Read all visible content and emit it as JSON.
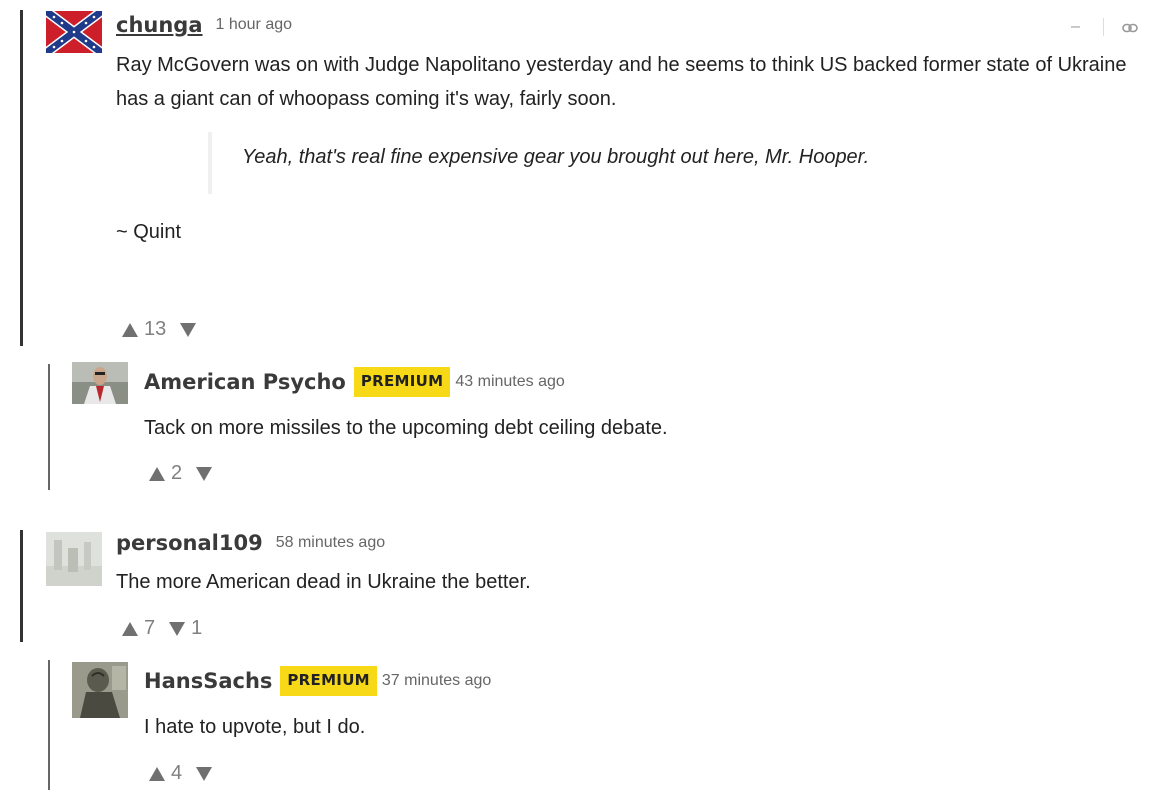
{
  "controls": {
    "collapse_glyph": "–",
    "link_icon": "link-icon"
  },
  "colors": {
    "premium_badge": "#f7d917",
    "thread_line": "#333333",
    "username": "#3a3a3a"
  },
  "comments": [
    {
      "username": "chunga",
      "timestamp": "1 hour ago",
      "body": "Ray McGovern was on with Judge Napolitano yesterday and he seems to think US backed former state of Ukraine has a giant can of whoopass coming it's way, fairly soon.",
      "quote": "Yeah, that's real fine expensive gear you brought out here, Mr. Hooper.",
      "signature": "~ Quint",
      "upvotes": "13",
      "avatar_icon": "confederate-flag-avatar"
    },
    {
      "username": "American Psycho",
      "badge": "PREMIUM",
      "timestamp": "43 minutes ago",
      "body": "Tack on more missiles to the upcoming debt ceiling debate.",
      "upvotes": "2",
      "avatar_icon": "person-photo-avatar"
    },
    {
      "username": "personal109",
      "timestamp": "58 minutes ago",
      "body": "The more American dead in Ukraine the better.",
      "upvotes": "7",
      "downvotes": "1",
      "avatar_icon": "faded-photo-avatar"
    },
    {
      "username": "HansSachs",
      "badge": "PREMIUM",
      "timestamp": "37 minutes ago",
      "body": "I hate to upvote, but I do.",
      "upvotes": "4",
      "avatar_icon": "statue-photo-avatar"
    }
  ]
}
